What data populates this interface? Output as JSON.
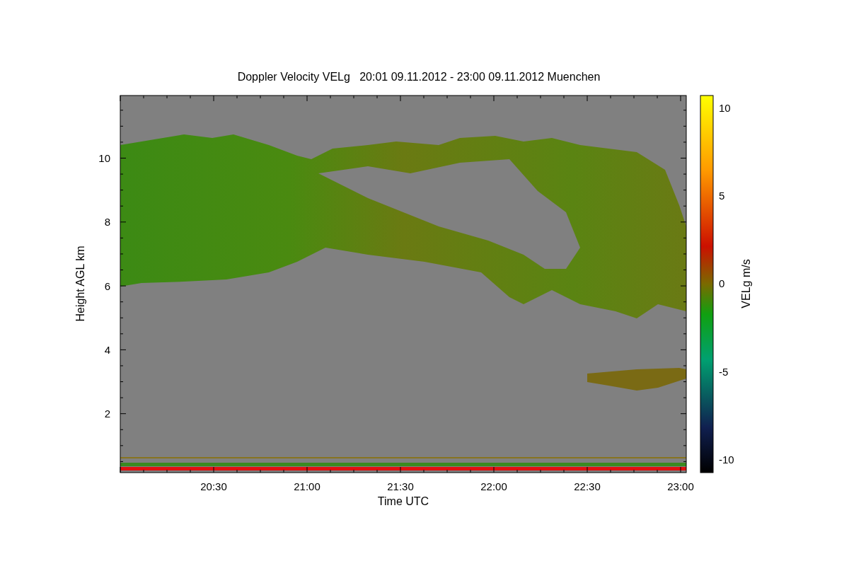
{
  "title": "Doppler Velocity VELg   20:01 09.11.2012 - 23:00 09.11.2012 Muenchen",
  "x_axis": {
    "label": "Time UTC",
    "ticks": [
      "20:30",
      "21:00",
      "21:30",
      "22:00",
      "22:30",
      "23:00"
    ]
  },
  "y_axis": {
    "label": "Height AGL km",
    "ticks": [
      "10",
      "8",
      "6",
      "4",
      "2"
    ]
  },
  "colorbar": {
    "label": "VELg m/s",
    "ticks": [
      "10",
      "5",
      "0",
      "-5",
      "-10"
    ]
  }
}
